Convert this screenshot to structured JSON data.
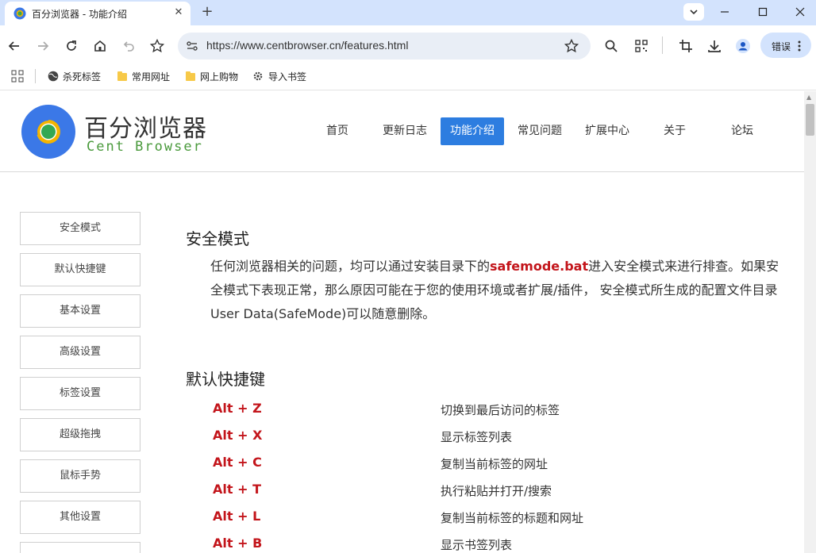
{
  "browser": {
    "tab_title": "百分浏览器 - 功能介绍",
    "url": "https://www.centbrowser.cn/features.html",
    "error_label": "错误",
    "bookmarks": [
      {
        "label": "杀死标签",
        "icon": "globe-icon"
      },
      {
        "label": "常用网址",
        "icon": "folder-icon"
      },
      {
        "label": "网上购物",
        "icon": "folder-icon"
      },
      {
        "label": "导入书签",
        "icon": "gear-icon"
      }
    ]
  },
  "site": {
    "logo_cn": "百分浏览器",
    "logo_en": "Cent Browser",
    "nav": [
      "首页",
      "更新日志",
      "功能介绍",
      "常见问题",
      "扩展中心",
      "关于",
      "论坛"
    ],
    "nav_active": "功能介绍",
    "accent_color": "#2d7de0",
    "highlight_color": "#c3151b"
  },
  "sidebar": [
    "安全模式",
    "默认快捷键",
    "基本设置",
    "高级设置",
    "标签设置",
    "超级拖拽",
    "鼠标手势",
    "其他设置"
  ],
  "content": {
    "safe_mode_title": "安全模式",
    "safe_mode_text_1": "任何浏览器相关的问题，均可以通过安装目录下的",
    "safe_mode_highlight": "safemode.bat",
    "safe_mode_text_2": "进入安全模式来进行排查。如果安全模式下表现正常，那么原因可能在于您的使用环境或者扩展/插件， 安全模式所生成的配置文件目录 User Data(SafeMode)可以随意删除。",
    "shortcuts_title": "默认快捷键",
    "shortcuts": [
      {
        "key": "Alt + Z",
        "desc": "切换到最后访问的标签"
      },
      {
        "key": "Alt + X",
        "desc": "显示标签列表"
      },
      {
        "key": "Alt + C",
        "desc": "复制当前标签的网址"
      },
      {
        "key": "Alt + T",
        "desc": "执行粘贴并打开/搜索"
      },
      {
        "key": "Alt + L",
        "desc": "复制当前标签的标题和网址"
      },
      {
        "key": "Alt + B",
        "desc": "显示书签列表"
      }
    ]
  }
}
